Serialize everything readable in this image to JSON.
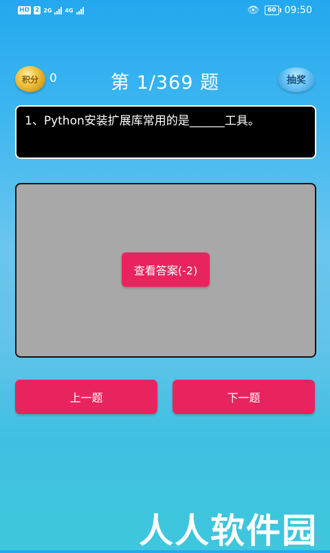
{
  "status_bar": {
    "hd_badge": "HD",
    "sim_badge": "2",
    "network_1": "2G",
    "network_2": "4G",
    "battery": "60",
    "time": "09:50"
  },
  "header": {
    "coin_label": "积分",
    "points": "0",
    "title": "第 1/369 题",
    "lottery_label": "抽奖"
  },
  "question": {
    "text": "1、Python安装扩展库常用的是______工具。"
  },
  "answer": {
    "reveal_button": "查看答案(-2)"
  },
  "navigation": {
    "prev_label": "上一题",
    "next_label": "下一题"
  },
  "watermark": "人人软件园"
}
